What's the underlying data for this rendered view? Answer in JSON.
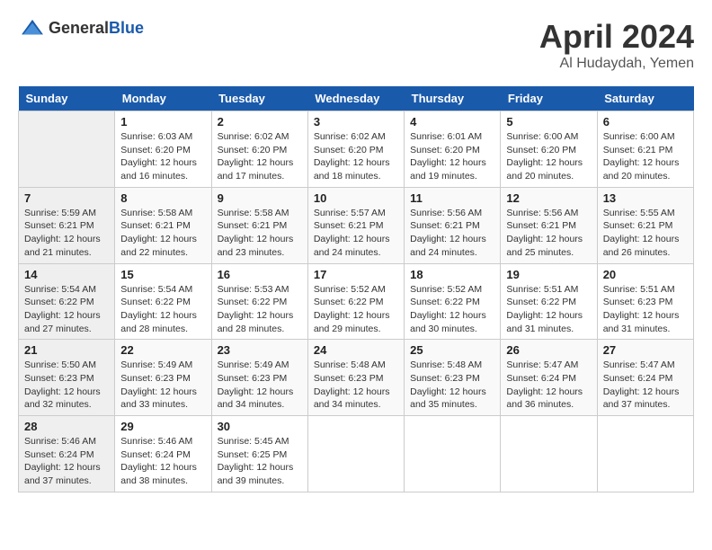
{
  "header": {
    "logo_general": "General",
    "logo_blue": "Blue",
    "month": "April 2024",
    "location": "Al Hudaydah, Yemen"
  },
  "days_of_week": [
    "Sunday",
    "Monday",
    "Tuesday",
    "Wednesday",
    "Thursday",
    "Friday",
    "Saturday"
  ],
  "weeks": [
    [
      {
        "day": "",
        "info": ""
      },
      {
        "day": "1",
        "info": "Sunrise: 6:03 AM\nSunset: 6:20 PM\nDaylight: 12 hours\nand 16 minutes."
      },
      {
        "day": "2",
        "info": "Sunrise: 6:02 AM\nSunset: 6:20 PM\nDaylight: 12 hours\nand 17 minutes."
      },
      {
        "day": "3",
        "info": "Sunrise: 6:02 AM\nSunset: 6:20 PM\nDaylight: 12 hours\nand 18 minutes."
      },
      {
        "day": "4",
        "info": "Sunrise: 6:01 AM\nSunset: 6:20 PM\nDaylight: 12 hours\nand 19 minutes."
      },
      {
        "day": "5",
        "info": "Sunrise: 6:00 AM\nSunset: 6:20 PM\nDaylight: 12 hours\nand 20 minutes."
      },
      {
        "day": "6",
        "info": "Sunrise: 6:00 AM\nSunset: 6:21 PM\nDaylight: 12 hours\nand 20 minutes."
      }
    ],
    [
      {
        "day": "7",
        "info": "Sunrise: 5:59 AM\nSunset: 6:21 PM\nDaylight: 12 hours\nand 21 minutes."
      },
      {
        "day": "8",
        "info": "Sunrise: 5:58 AM\nSunset: 6:21 PM\nDaylight: 12 hours\nand 22 minutes."
      },
      {
        "day": "9",
        "info": "Sunrise: 5:58 AM\nSunset: 6:21 PM\nDaylight: 12 hours\nand 23 minutes."
      },
      {
        "day": "10",
        "info": "Sunrise: 5:57 AM\nSunset: 6:21 PM\nDaylight: 12 hours\nand 24 minutes."
      },
      {
        "day": "11",
        "info": "Sunrise: 5:56 AM\nSunset: 6:21 PM\nDaylight: 12 hours\nand 24 minutes."
      },
      {
        "day": "12",
        "info": "Sunrise: 5:56 AM\nSunset: 6:21 PM\nDaylight: 12 hours\nand 25 minutes."
      },
      {
        "day": "13",
        "info": "Sunrise: 5:55 AM\nSunset: 6:21 PM\nDaylight: 12 hours\nand 26 minutes."
      }
    ],
    [
      {
        "day": "14",
        "info": "Sunrise: 5:54 AM\nSunset: 6:22 PM\nDaylight: 12 hours\nand 27 minutes."
      },
      {
        "day": "15",
        "info": "Sunrise: 5:54 AM\nSunset: 6:22 PM\nDaylight: 12 hours\nand 28 minutes."
      },
      {
        "day": "16",
        "info": "Sunrise: 5:53 AM\nSunset: 6:22 PM\nDaylight: 12 hours\nand 28 minutes."
      },
      {
        "day": "17",
        "info": "Sunrise: 5:52 AM\nSunset: 6:22 PM\nDaylight: 12 hours\nand 29 minutes."
      },
      {
        "day": "18",
        "info": "Sunrise: 5:52 AM\nSunset: 6:22 PM\nDaylight: 12 hours\nand 30 minutes."
      },
      {
        "day": "19",
        "info": "Sunrise: 5:51 AM\nSunset: 6:22 PM\nDaylight: 12 hours\nand 31 minutes."
      },
      {
        "day": "20",
        "info": "Sunrise: 5:51 AM\nSunset: 6:23 PM\nDaylight: 12 hours\nand 31 minutes."
      }
    ],
    [
      {
        "day": "21",
        "info": "Sunrise: 5:50 AM\nSunset: 6:23 PM\nDaylight: 12 hours\nand 32 minutes."
      },
      {
        "day": "22",
        "info": "Sunrise: 5:49 AM\nSunset: 6:23 PM\nDaylight: 12 hours\nand 33 minutes."
      },
      {
        "day": "23",
        "info": "Sunrise: 5:49 AM\nSunset: 6:23 PM\nDaylight: 12 hours\nand 34 minutes."
      },
      {
        "day": "24",
        "info": "Sunrise: 5:48 AM\nSunset: 6:23 PM\nDaylight: 12 hours\nand 34 minutes."
      },
      {
        "day": "25",
        "info": "Sunrise: 5:48 AM\nSunset: 6:23 PM\nDaylight: 12 hours\nand 35 minutes."
      },
      {
        "day": "26",
        "info": "Sunrise: 5:47 AM\nSunset: 6:24 PM\nDaylight: 12 hours\nand 36 minutes."
      },
      {
        "day": "27",
        "info": "Sunrise: 5:47 AM\nSunset: 6:24 PM\nDaylight: 12 hours\nand 37 minutes."
      }
    ],
    [
      {
        "day": "28",
        "info": "Sunrise: 5:46 AM\nSunset: 6:24 PM\nDaylight: 12 hours\nand 37 minutes."
      },
      {
        "day": "29",
        "info": "Sunrise: 5:46 AM\nSunset: 6:24 PM\nDaylight: 12 hours\nand 38 minutes."
      },
      {
        "day": "30",
        "info": "Sunrise: 5:45 AM\nSunset: 6:25 PM\nDaylight: 12 hours\nand 39 minutes."
      },
      {
        "day": "",
        "info": ""
      },
      {
        "day": "",
        "info": ""
      },
      {
        "day": "",
        "info": ""
      },
      {
        "day": "",
        "info": ""
      }
    ]
  ]
}
